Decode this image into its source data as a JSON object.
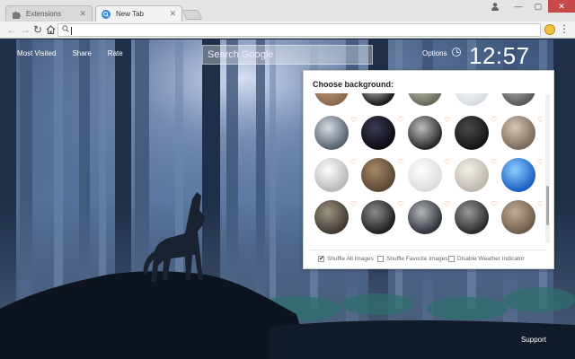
{
  "browser": {
    "tabs": [
      {
        "title": "Extensions",
        "active": false
      },
      {
        "title": "New Tab",
        "active": true
      }
    ],
    "omnibox_value": "",
    "accent_color": "#c74a4a"
  },
  "page": {
    "links": [
      "Most Visited",
      "Share",
      "Rate"
    ],
    "search_placeholder": "Search Google",
    "options_label": "Options",
    "clock_time": "12:57",
    "support_label": "Support"
  },
  "panel": {
    "title": "Choose background:",
    "options": [
      {
        "label": "Shuffle All Images",
        "checked": true
      },
      {
        "label": "Shuffle Favorite Images",
        "checked": false
      },
      {
        "label": "Disable Weather Indicator",
        "checked": false
      }
    ],
    "scroll_position": 0.6,
    "heart_color": "#f2803a"
  }
}
